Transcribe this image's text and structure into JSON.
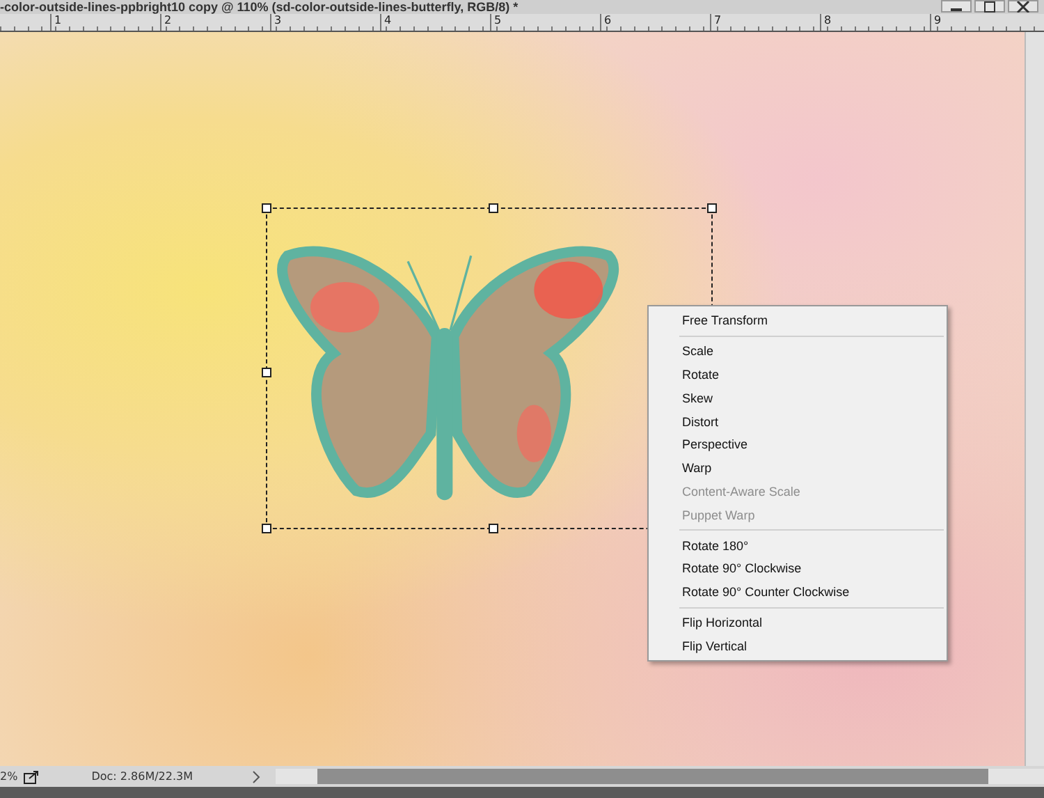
{
  "window": {
    "title": "-color-outside-lines-ppbright10 copy @ 110% (sd-color-outside-lines-butterfly, RGB/8) *"
  },
  "ruler": {
    "labels": [
      "1",
      "2",
      "3",
      "4",
      "5",
      "6",
      "7",
      "8",
      "9"
    ]
  },
  "context_menu": {
    "groups": [
      [
        {
          "label": "Free Transform",
          "disabled": false
        }
      ],
      [
        {
          "label": "Scale",
          "disabled": false
        },
        {
          "label": "Rotate",
          "disabled": false
        },
        {
          "label": "Skew",
          "disabled": false
        },
        {
          "label": "Distort",
          "disabled": false
        },
        {
          "label": "Perspective",
          "disabled": false
        },
        {
          "label": "Warp",
          "disabled": false
        },
        {
          "label": "Content-Aware Scale",
          "disabled": true
        },
        {
          "label": "Puppet Warp",
          "disabled": true
        }
      ],
      [
        {
          "label": "Rotate 180°",
          "disabled": false
        },
        {
          "label": "Rotate 90° Clockwise",
          "disabled": false
        },
        {
          "label": "Rotate 90° Counter Clockwise",
          "disabled": false
        }
      ],
      [
        {
          "label": "Flip Horizontal",
          "disabled": false
        },
        {
          "label": "Flip Vertical",
          "disabled": false
        }
      ]
    ]
  },
  "status_bar": {
    "zoom": "2%",
    "doc_size": "Doc: 2.86M/22.3M"
  }
}
